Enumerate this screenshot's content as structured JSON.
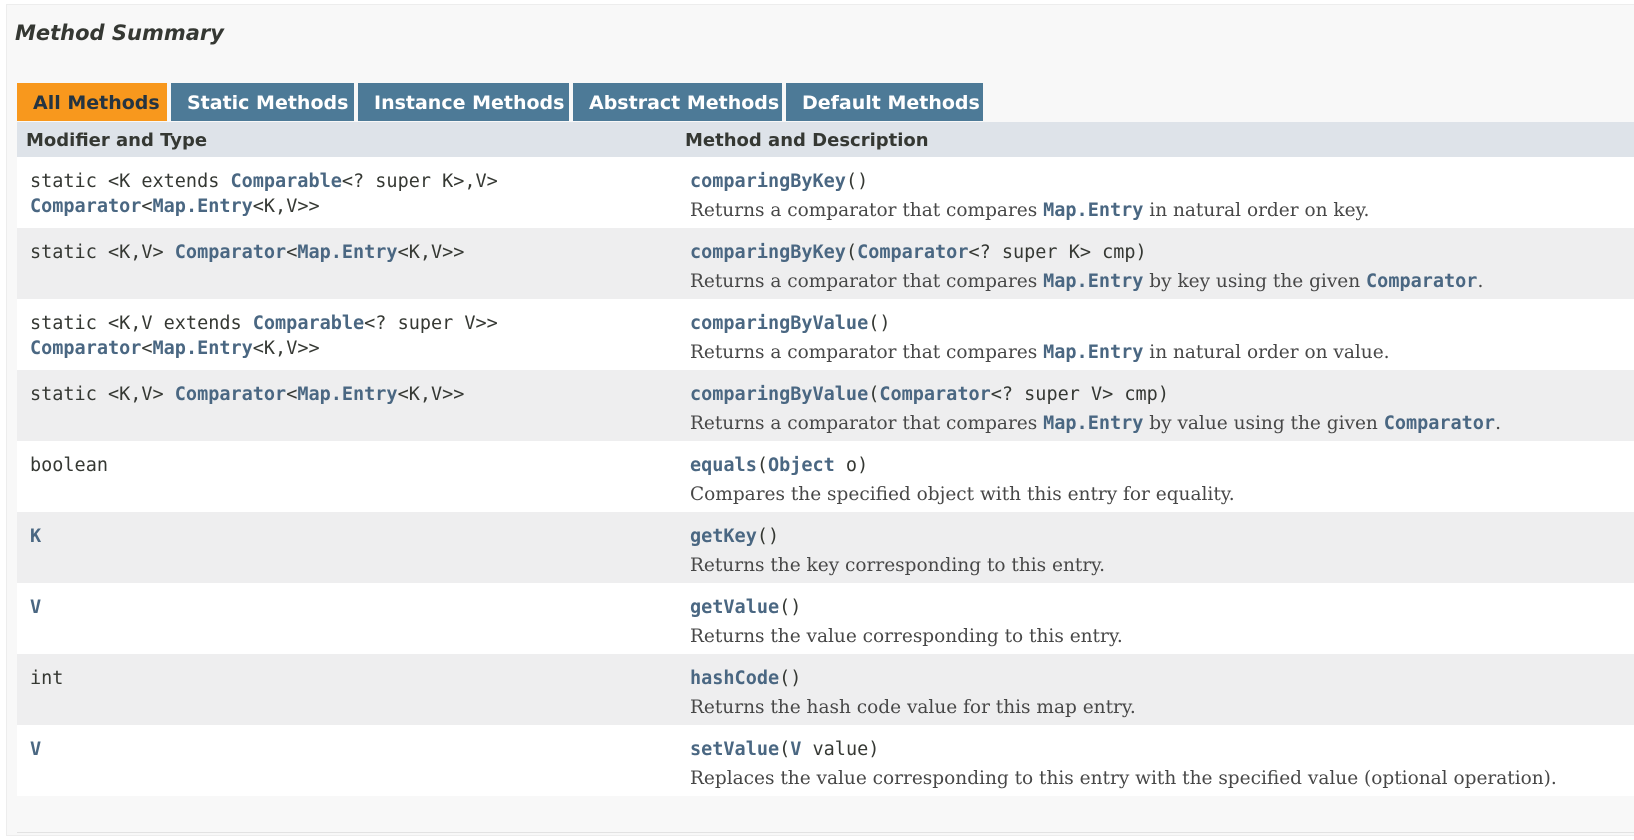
{
  "section": {
    "title": "Method Summary"
  },
  "tabs": [
    {
      "label": "All Methods",
      "active": true
    },
    {
      "label": "Static Methods",
      "active": false
    },
    {
      "label": "Instance Methods",
      "active": false
    },
    {
      "label": "Abstract Methods",
      "active": false
    },
    {
      "label": "Default Methods",
      "active": false
    }
  ],
  "table": {
    "headers": {
      "modifier": "Modifier and Type",
      "method": "Method and Description"
    },
    "rows": [
      {
        "mod_l1a": "static <K extends ",
        "mod_l1_link": "Comparable",
        "mod_l1b": "<? super K>,V>",
        "mod_l2_link1": "Comparator",
        "mod_l2_t1": "<",
        "mod_l2_link2": "Map.Entry",
        "mod_l2_t2": "<K,V>>",
        "method_name": "comparingByKey",
        "sig_rest": "()",
        "desc_a": "Returns a comparator that compares ",
        "desc_code": "Map.Entry",
        "desc_b": " in natural order on key."
      },
      {
        "mod_t0": "static <K,V> ",
        "mod_link1": "Comparator",
        "mod_t1": "<",
        "mod_link2": "Map.Entry",
        "mod_t2": "<K,V>>",
        "method_name": "comparingByKey",
        "sig_open": "(",
        "param_link": "Comparator",
        "sig_rest": "<? super K> cmp)",
        "desc_a": "Returns a comparator that compares ",
        "desc_code": "Map.Entry",
        "desc_b": " by key using the given ",
        "desc_code2": "Comparator",
        "desc_c": "."
      },
      {
        "mod_l1a": "static <K,V extends ",
        "mod_l1_link": "Comparable",
        "mod_l1b": "<? super V>>",
        "mod_l2_link1": "Comparator",
        "mod_l2_t1": "<",
        "mod_l2_link2": "Map.Entry",
        "mod_l2_t2": "<K,V>>",
        "method_name": "comparingByValue",
        "sig_rest": "()",
        "desc_a": "Returns a comparator that compares ",
        "desc_code": "Map.Entry",
        "desc_b": " in natural order on value."
      },
      {
        "mod_t0": "static <K,V> ",
        "mod_link1": "Comparator",
        "mod_t1": "<",
        "mod_link2": "Map.Entry",
        "mod_t2": "<K,V>>",
        "method_name": "comparingByValue",
        "sig_open": "(",
        "param_link": "Comparator",
        "sig_rest": "<? super V> cmp)",
        "desc_a": "Returns a comparator that compares ",
        "desc_code": "Map.Entry",
        "desc_b": " by value using the given ",
        "desc_code2": "Comparator",
        "desc_c": "."
      },
      {
        "modifier": "boolean",
        "method_name": "equals",
        "sig_open": "(",
        "param_link": "Object",
        "sig_rest": " o)",
        "desc_a": "Compares the specified object with this entry for equality."
      },
      {
        "modifier_link": "K",
        "method_name": "getKey",
        "sig_rest": "()",
        "desc_a": "Returns the key corresponding to this entry."
      },
      {
        "modifier_link": "V",
        "method_name": "getValue",
        "sig_rest": "()",
        "desc_a": "Returns the value corresponding to this entry."
      },
      {
        "modifier": "int",
        "method_name": "hashCode",
        "sig_rest": "()",
        "desc_a": "Returns the hash code value for this map entry."
      },
      {
        "modifier_link": "V",
        "method_name": "setValue",
        "sig_open": "(",
        "param_link": "V",
        "sig_rest": " value)",
        "desc_a": "Replaces the value corresponding to this entry with the specified value (optional operation)."
      }
    ]
  }
}
